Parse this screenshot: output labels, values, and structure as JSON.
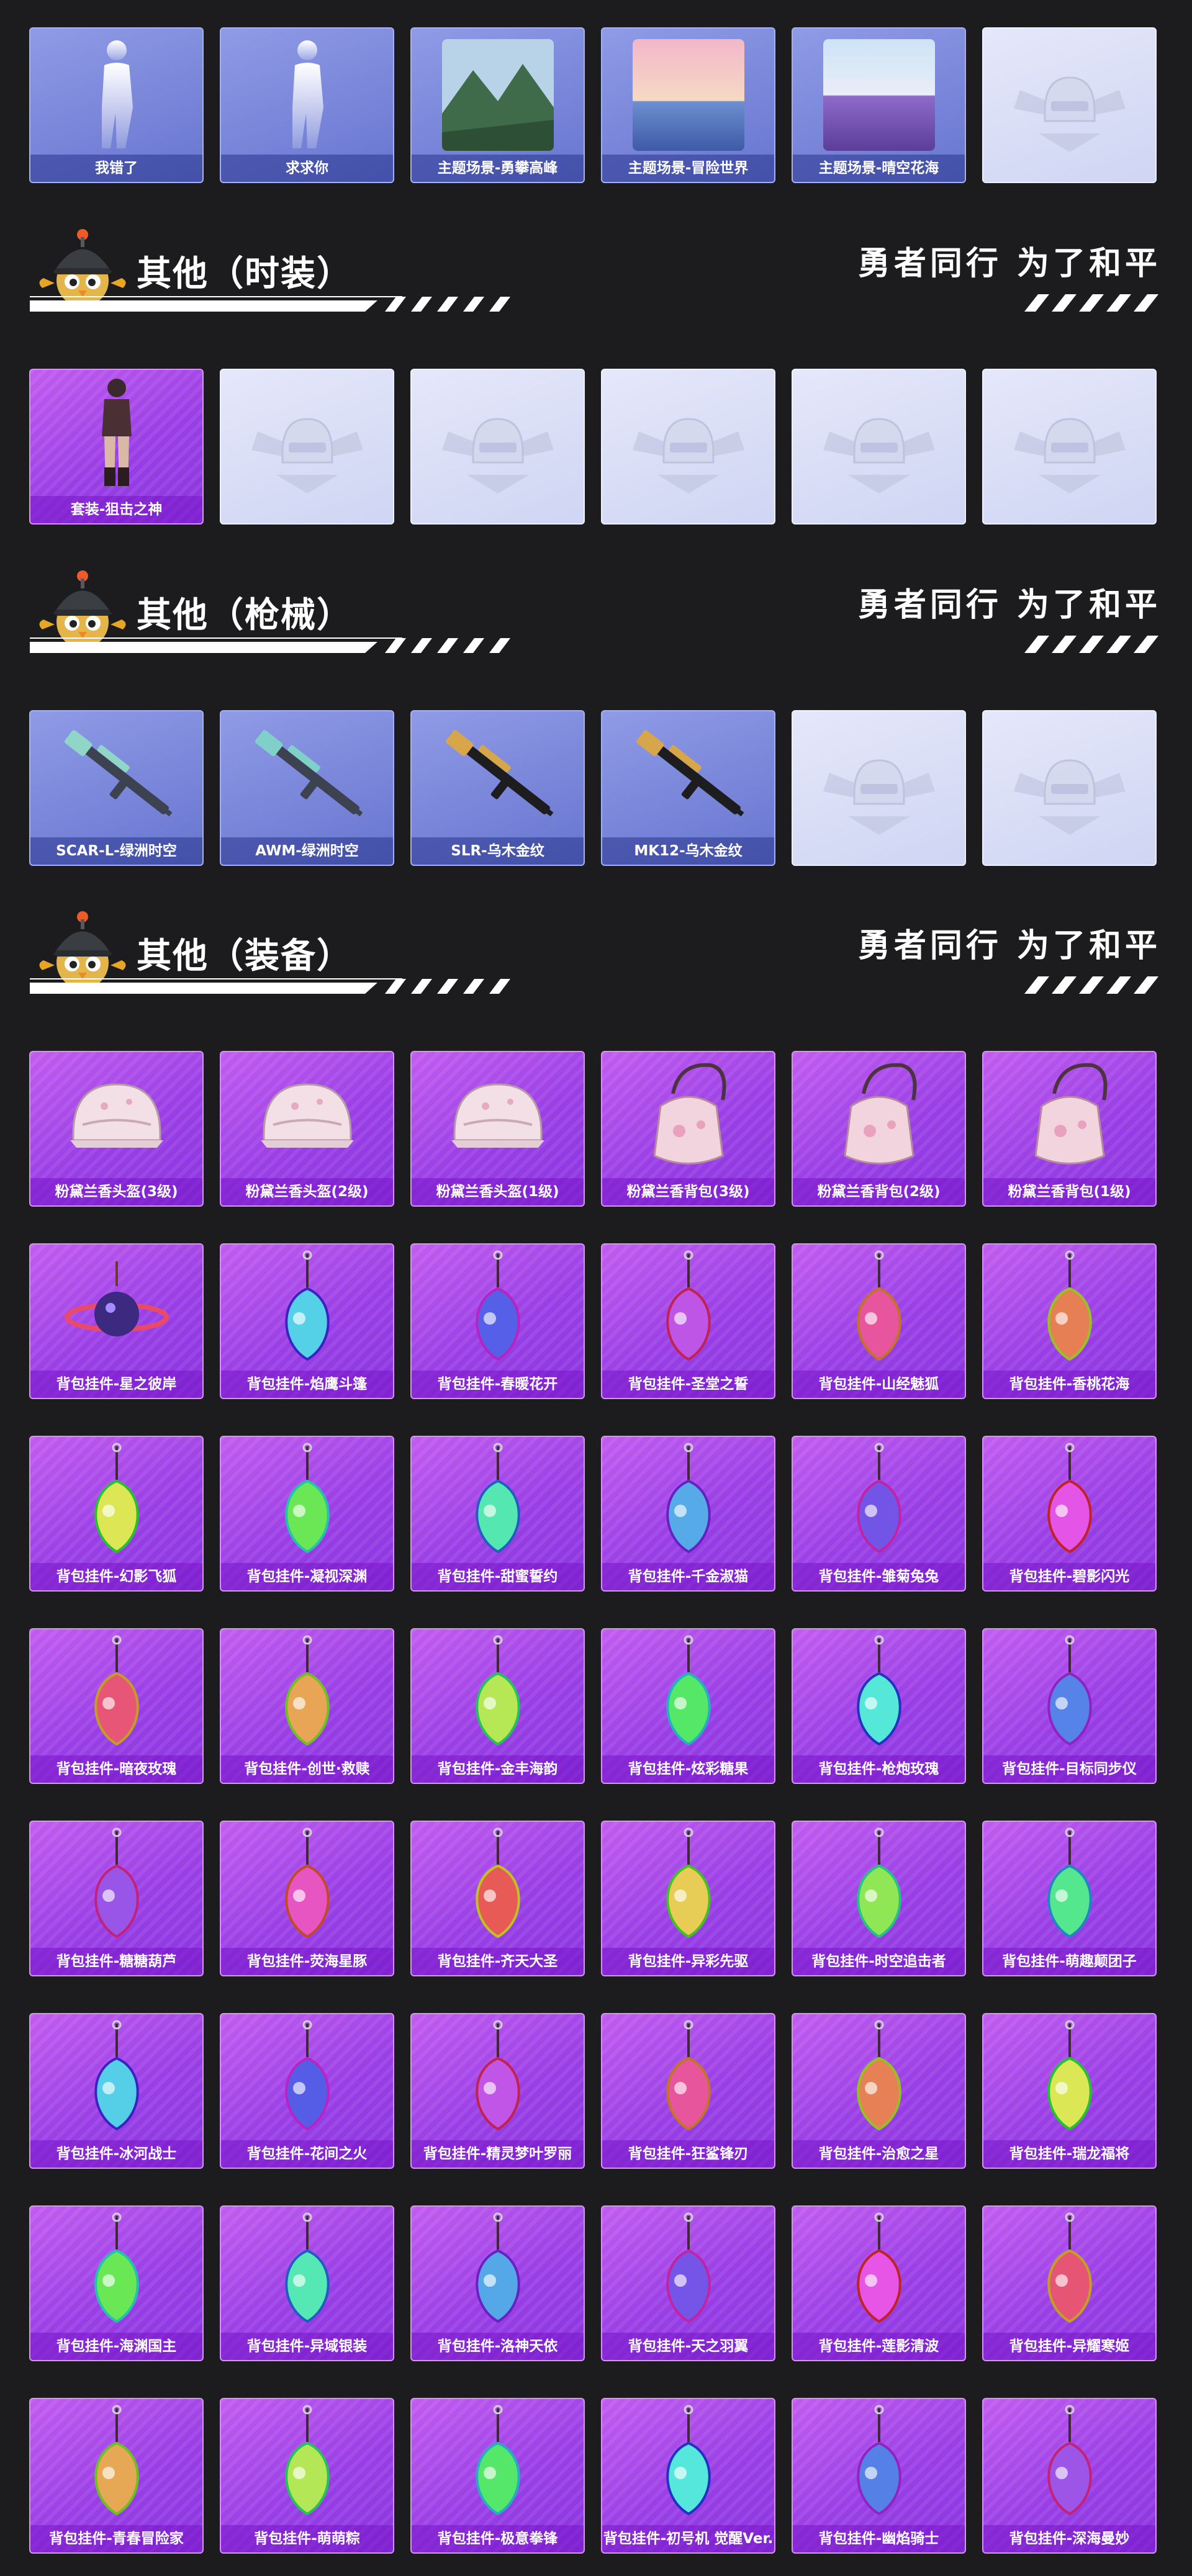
{
  "slogan": "勇者同行 为了和平",
  "colors": {
    "page_background": "#1c1c1e",
    "card_blue": "#7682d8",
    "card_purple": "#a84ae8",
    "card_empty": "#dde1f7",
    "label_text": "#ffffff"
  },
  "top_row": {
    "items": [
      {
        "label": "我错了",
        "style": "blue",
        "icon": "pose-figure-icon"
      },
      {
        "label": "求求你",
        "style": "blue",
        "icon": "pose-figure-icon"
      },
      {
        "label": "主题场景-勇攀高峰",
        "style": "blue",
        "icon": "mountain-scene-icon"
      },
      {
        "label": "主题场景-冒险世界",
        "style": "blue",
        "icon": "sunset-sea-scene-icon"
      },
      {
        "label": "主题场景-晴空花海",
        "style": "blue",
        "icon": "flower-field-scene-icon"
      },
      {
        "label": "",
        "style": "empty",
        "icon": "placeholder-emblem-icon"
      }
    ]
  },
  "sections": [
    {
      "title": "其他（时装）",
      "items": [
        {
          "label": "套装-狙击之神",
          "style": "purple",
          "icon": "outfit-figure-icon"
        },
        {
          "label": "",
          "style": "empty",
          "icon": "placeholder-emblem-icon"
        },
        {
          "label": "",
          "style": "empty",
          "icon": "placeholder-emblem-icon"
        },
        {
          "label": "",
          "style": "empty",
          "icon": "placeholder-emblem-icon"
        },
        {
          "label": "",
          "style": "empty",
          "icon": "placeholder-emblem-icon"
        },
        {
          "label": "",
          "style": "empty",
          "icon": "placeholder-emblem-icon"
        }
      ]
    },
    {
      "title": "其他（枪械）",
      "items": [
        {
          "label": "SCAR-L-绿洲时空",
          "style": "blue",
          "icon": "rifle-icon"
        },
        {
          "label": "AWM-绿洲时空",
          "style": "blue",
          "icon": "sniper-rifle-icon"
        },
        {
          "label": "SLR-乌木金纹",
          "style": "blue",
          "icon": "gold-rifle-icon"
        },
        {
          "label": "MK12-乌木金纹",
          "style": "blue",
          "icon": "gold-rifle-icon"
        },
        {
          "label": "",
          "style": "empty",
          "icon": "placeholder-emblem-icon"
        },
        {
          "label": "",
          "style": "empty",
          "icon": "placeholder-emblem-icon"
        }
      ]
    },
    {
      "title": "其他（装备）",
      "items": [
        {
          "label": "粉黛兰香头盔(3级)",
          "style": "purple",
          "icon": "helmet-icon"
        },
        {
          "label": "粉黛兰香头盔(2级)",
          "style": "purple",
          "icon": "helmet-icon"
        },
        {
          "label": "粉黛兰香头盔(1级)",
          "style": "purple",
          "icon": "helmet-icon"
        },
        {
          "label": "粉黛兰香背包(3级)",
          "style": "purple",
          "icon": "backpack-icon"
        },
        {
          "label": "粉黛兰香背包(2级)",
          "style": "purple",
          "icon": "backpack-icon"
        },
        {
          "label": "粉黛兰香背包(1级)",
          "style": "purple",
          "icon": "backpack-icon"
        },
        {
          "label": "背包挂件-星之彼岸",
          "style": "purple",
          "icon": "planet-charm-icon"
        },
        {
          "label": "背包挂件-焰鹰斗篷",
          "style": "purple",
          "icon": "charm-icon"
        },
        {
          "label": "背包挂件-春暖花开",
          "style": "purple",
          "icon": "charm-icon"
        },
        {
          "label": "背包挂件-圣堂之誓",
          "style": "purple",
          "icon": "charm-icon"
        },
        {
          "label": "背包挂件-山经魅狐",
          "style": "purple",
          "icon": "charm-icon"
        },
        {
          "label": "背包挂件-香桃花海",
          "style": "purple",
          "icon": "charm-icon"
        },
        {
          "label": "背包挂件-幻影飞狐",
          "style": "purple",
          "icon": "charm-icon"
        },
        {
          "label": "背包挂件-凝视深渊",
          "style": "purple",
          "icon": "charm-icon"
        },
        {
          "label": "背包挂件-甜蜜誓约",
          "style": "purple",
          "icon": "charm-icon"
        },
        {
          "label": "背包挂件-千金淑猫",
          "style": "purple",
          "icon": "charm-icon"
        },
        {
          "label": "背包挂件-雏菊兔兔",
          "style": "purple",
          "icon": "charm-icon"
        },
        {
          "label": "背包挂件-碧影闪光",
          "style": "purple",
          "icon": "charm-icon"
        },
        {
          "label": "背包挂件-暗夜玫瑰",
          "style": "purple",
          "icon": "charm-icon"
        },
        {
          "label": "背包挂件-创世·救赎",
          "style": "purple",
          "icon": "charm-icon"
        },
        {
          "label": "背包挂件-金丰海韵",
          "style": "purple",
          "icon": "charm-icon"
        },
        {
          "label": "背包挂件-炫彩糖果",
          "style": "purple",
          "icon": "charm-icon"
        },
        {
          "label": "背包挂件-枪炮玫瑰",
          "style": "purple",
          "icon": "charm-icon"
        },
        {
          "label": "背包挂件-目标同步仪",
          "style": "purple",
          "icon": "charm-icon"
        },
        {
          "label": "背包挂件-糖糖葫芦",
          "style": "purple",
          "icon": "charm-icon"
        },
        {
          "label": "背包挂件-荧海星豚",
          "style": "purple",
          "icon": "charm-icon"
        },
        {
          "label": "背包挂件-齐天大圣",
          "style": "purple",
          "icon": "charm-icon"
        },
        {
          "label": "背包挂件-异彩先驱",
          "style": "purple",
          "icon": "charm-icon"
        },
        {
          "label": "背包挂件-时空追击者",
          "style": "purple",
          "icon": "charm-icon"
        },
        {
          "label": "背包挂件-萌趣颠团子",
          "style": "purple",
          "icon": "charm-icon"
        },
        {
          "label": "背包挂件-冰河战士",
          "style": "purple",
          "icon": "charm-icon"
        },
        {
          "label": "背包挂件-花间之火",
          "style": "purple",
          "icon": "charm-icon"
        },
        {
          "label": "背包挂件-精灵梦叶罗丽",
          "style": "purple",
          "icon": "charm-icon"
        },
        {
          "label": "背包挂件-狂鲨锋刃",
          "style": "purple",
          "icon": "charm-icon"
        },
        {
          "label": "背包挂件-治愈之星",
          "style": "purple",
          "icon": "charm-icon"
        },
        {
          "label": "背包挂件-瑞龙福将",
          "style": "purple",
          "icon": "charm-icon"
        },
        {
          "label": "背包挂件-海渊国主",
          "style": "purple",
          "icon": "charm-icon"
        },
        {
          "label": "背包挂件-异域银装",
          "style": "purple",
          "icon": "charm-icon"
        },
        {
          "label": "背包挂件-洛神天依",
          "style": "purple",
          "icon": "charm-icon"
        },
        {
          "label": "背包挂件-天之羽翼",
          "style": "purple",
          "icon": "charm-icon"
        },
        {
          "label": "背包挂件-莲影清波",
          "style": "purple",
          "icon": "charm-icon"
        },
        {
          "label": "背包挂件-异耀寒姬",
          "style": "purple",
          "icon": "charm-icon"
        },
        {
          "label": "背包挂件-青春冒险家",
          "style": "purple",
          "icon": "charm-icon"
        },
        {
          "label": "背包挂件-萌萌粽",
          "style": "purple",
          "icon": "charm-icon"
        },
        {
          "label": "背包挂件-极意拳锋",
          "style": "purple",
          "icon": "charm-icon"
        },
        {
          "label": "背包挂件-初号机 觉醒Ver.",
          "style": "purple",
          "icon": "charm-icon"
        },
        {
          "label": "背包挂件-幽焰骑士",
          "style": "purple",
          "icon": "charm-icon"
        },
        {
          "label": "背包挂件-深海曼妙",
          "style": "purple",
          "icon": "charm-icon"
        }
      ]
    }
  ]
}
